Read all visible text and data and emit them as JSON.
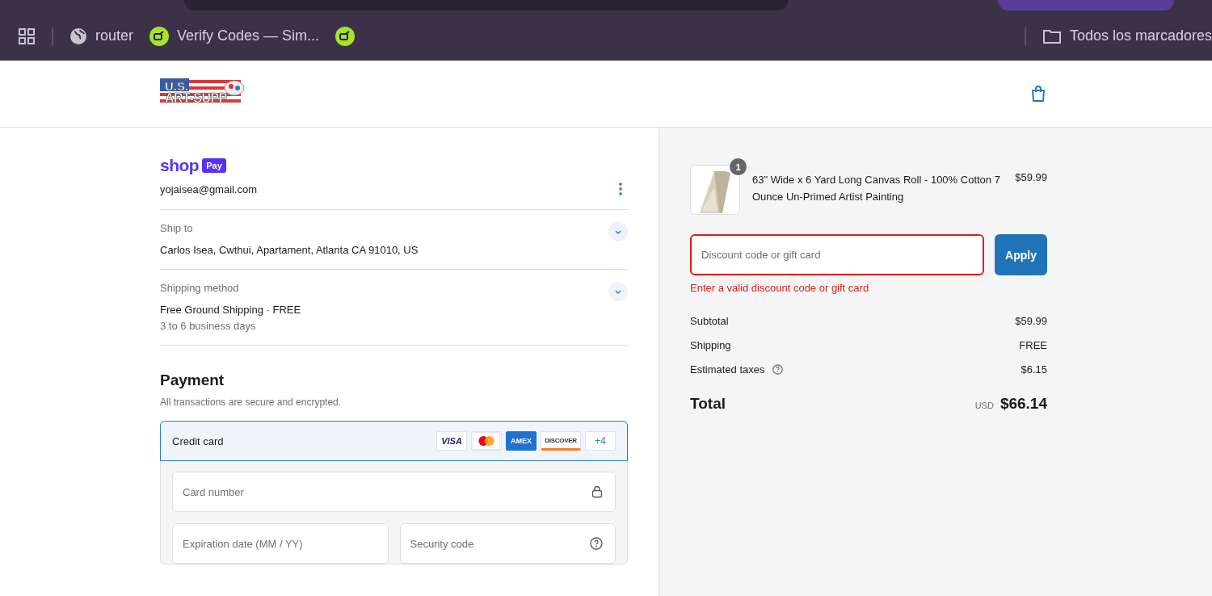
{
  "browser": {
    "bookmarks": [
      {
        "kind": "apps"
      },
      {
        "kind": "globe",
        "label": "router"
      },
      {
        "kind": "extension",
        "label": "Verify Codes — Sim..."
      },
      {
        "kind": "extension"
      }
    ],
    "all_bookmarks": "Todos los marcadores"
  },
  "store": {
    "logo_top": "U.S.",
    "logo_bottom": "ART-SUPP"
  },
  "shop_pay": {
    "wordmark": "shop",
    "badge": "Pay",
    "email": "yojaisea@gmail.com"
  },
  "sections": [
    {
      "label": "Ship to",
      "value": "Carlos Isea, Cwthui, Apartament, Atlanta CA 91010, US"
    },
    {
      "label": "Shipping method",
      "value": "Free Ground Shipping · FREE",
      "detail": "3 to 6 business days"
    }
  ],
  "payment": {
    "title": "Payment",
    "subtitle": "All transactions are secure and encrypted.",
    "method": {
      "label": "Credit card",
      "selected": true,
      "brands": [
        {
          "kind": "visa",
          "label": "VISA"
        },
        {
          "kind": "mastercard"
        },
        {
          "kind": "amex",
          "label": "AMEX"
        },
        {
          "kind": "discover",
          "label": "DISCOVER"
        }
      ],
      "more": "+4"
    },
    "fields": [
      {
        "kind": "card-number",
        "placeholder": "Card number"
      },
      {
        "kind": "expiry",
        "placeholder": "Expiration date (MM / YY)"
      },
      {
        "kind": "security-code",
        "placeholder": "Security code"
      }
    ]
  },
  "order": {
    "items": [
      {
        "title": "63\" Wide x 6 Yard Long Canvas Roll - 100% Cotton 7 Ounce Un-Primed Artist Painting",
        "quantity": "1",
        "price": "$59.99"
      }
    ],
    "discount": {
      "placeholder": "Discount code or gift card",
      "error": "Enter a valid discount code or gift card",
      "button": "Apply"
    },
    "summary": [
      {
        "label": "Subtotal",
        "value": "$59.99",
        "info": false
      },
      {
        "label": "Shipping",
        "value": "FREE",
        "info": false
      },
      {
        "label": "Estimated taxes",
        "value": "$6.15",
        "info": true
      }
    ],
    "total": {
      "label": "Total",
      "currency": "USD",
      "value": "$66.14"
    }
  }
}
